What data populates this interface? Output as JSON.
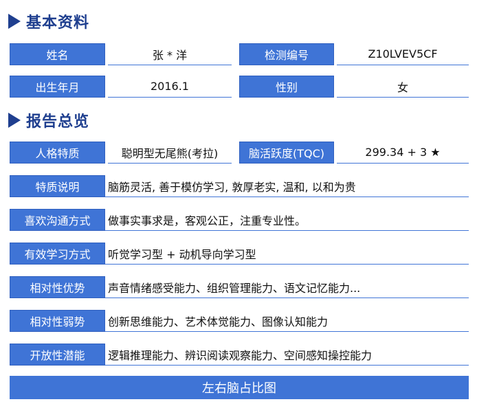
{
  "sections": {
    "basic_title": "基本资料",
    "report_title": "报告总览"
  },
  "basic": {
    "name_label": "姓名",
    "name_value": "张 * 洋",
    "code_label": "检测编号",
    "code_value": "Z10LVEV5CF",
    "birth_label": "出生年月",
    "birth_value": "2016.1",
    "gender_label": "性别",
    "gender_value": "女"
  },
  "report": {
    "personality_label": "人格特质",
    "personality_value": "聪明型无尾熊(考拉)",
    "activity_label": "脑活跃度(TQC)",
    "activity_value": "299.34 + 3 ★",
    "rows": [
      {
        "label": "特质说明",
        "value": "脑筋灵活, 善于模仿学习, 敦厚老实, 温和, 以和为贵"
      },
      {
        "label": "喜欢沟通方式",
        "value": "做事实事求是，客观公正，注重专业性。"
      },
      {
        "label": "有效学习方式",
        "value": "听觉学习型 + 动机导向学习型"
      },
      {
        "label": "相对性优势",
        "value": "声音情绪感受能力、组织管理能力、语文记忆能力..."
      },
      {
        "label": "相对性弱势",
        "value": "创新思维能力、艺术体觉能力、图像认知能力"
      },
      {
        "label": "开放性潜能",
        "value": "逻辑推理能力、辨识阅读观察能力、空间感知操控能力"
      }
    ],
    "banner": "左右脑占比图"
  }
}
